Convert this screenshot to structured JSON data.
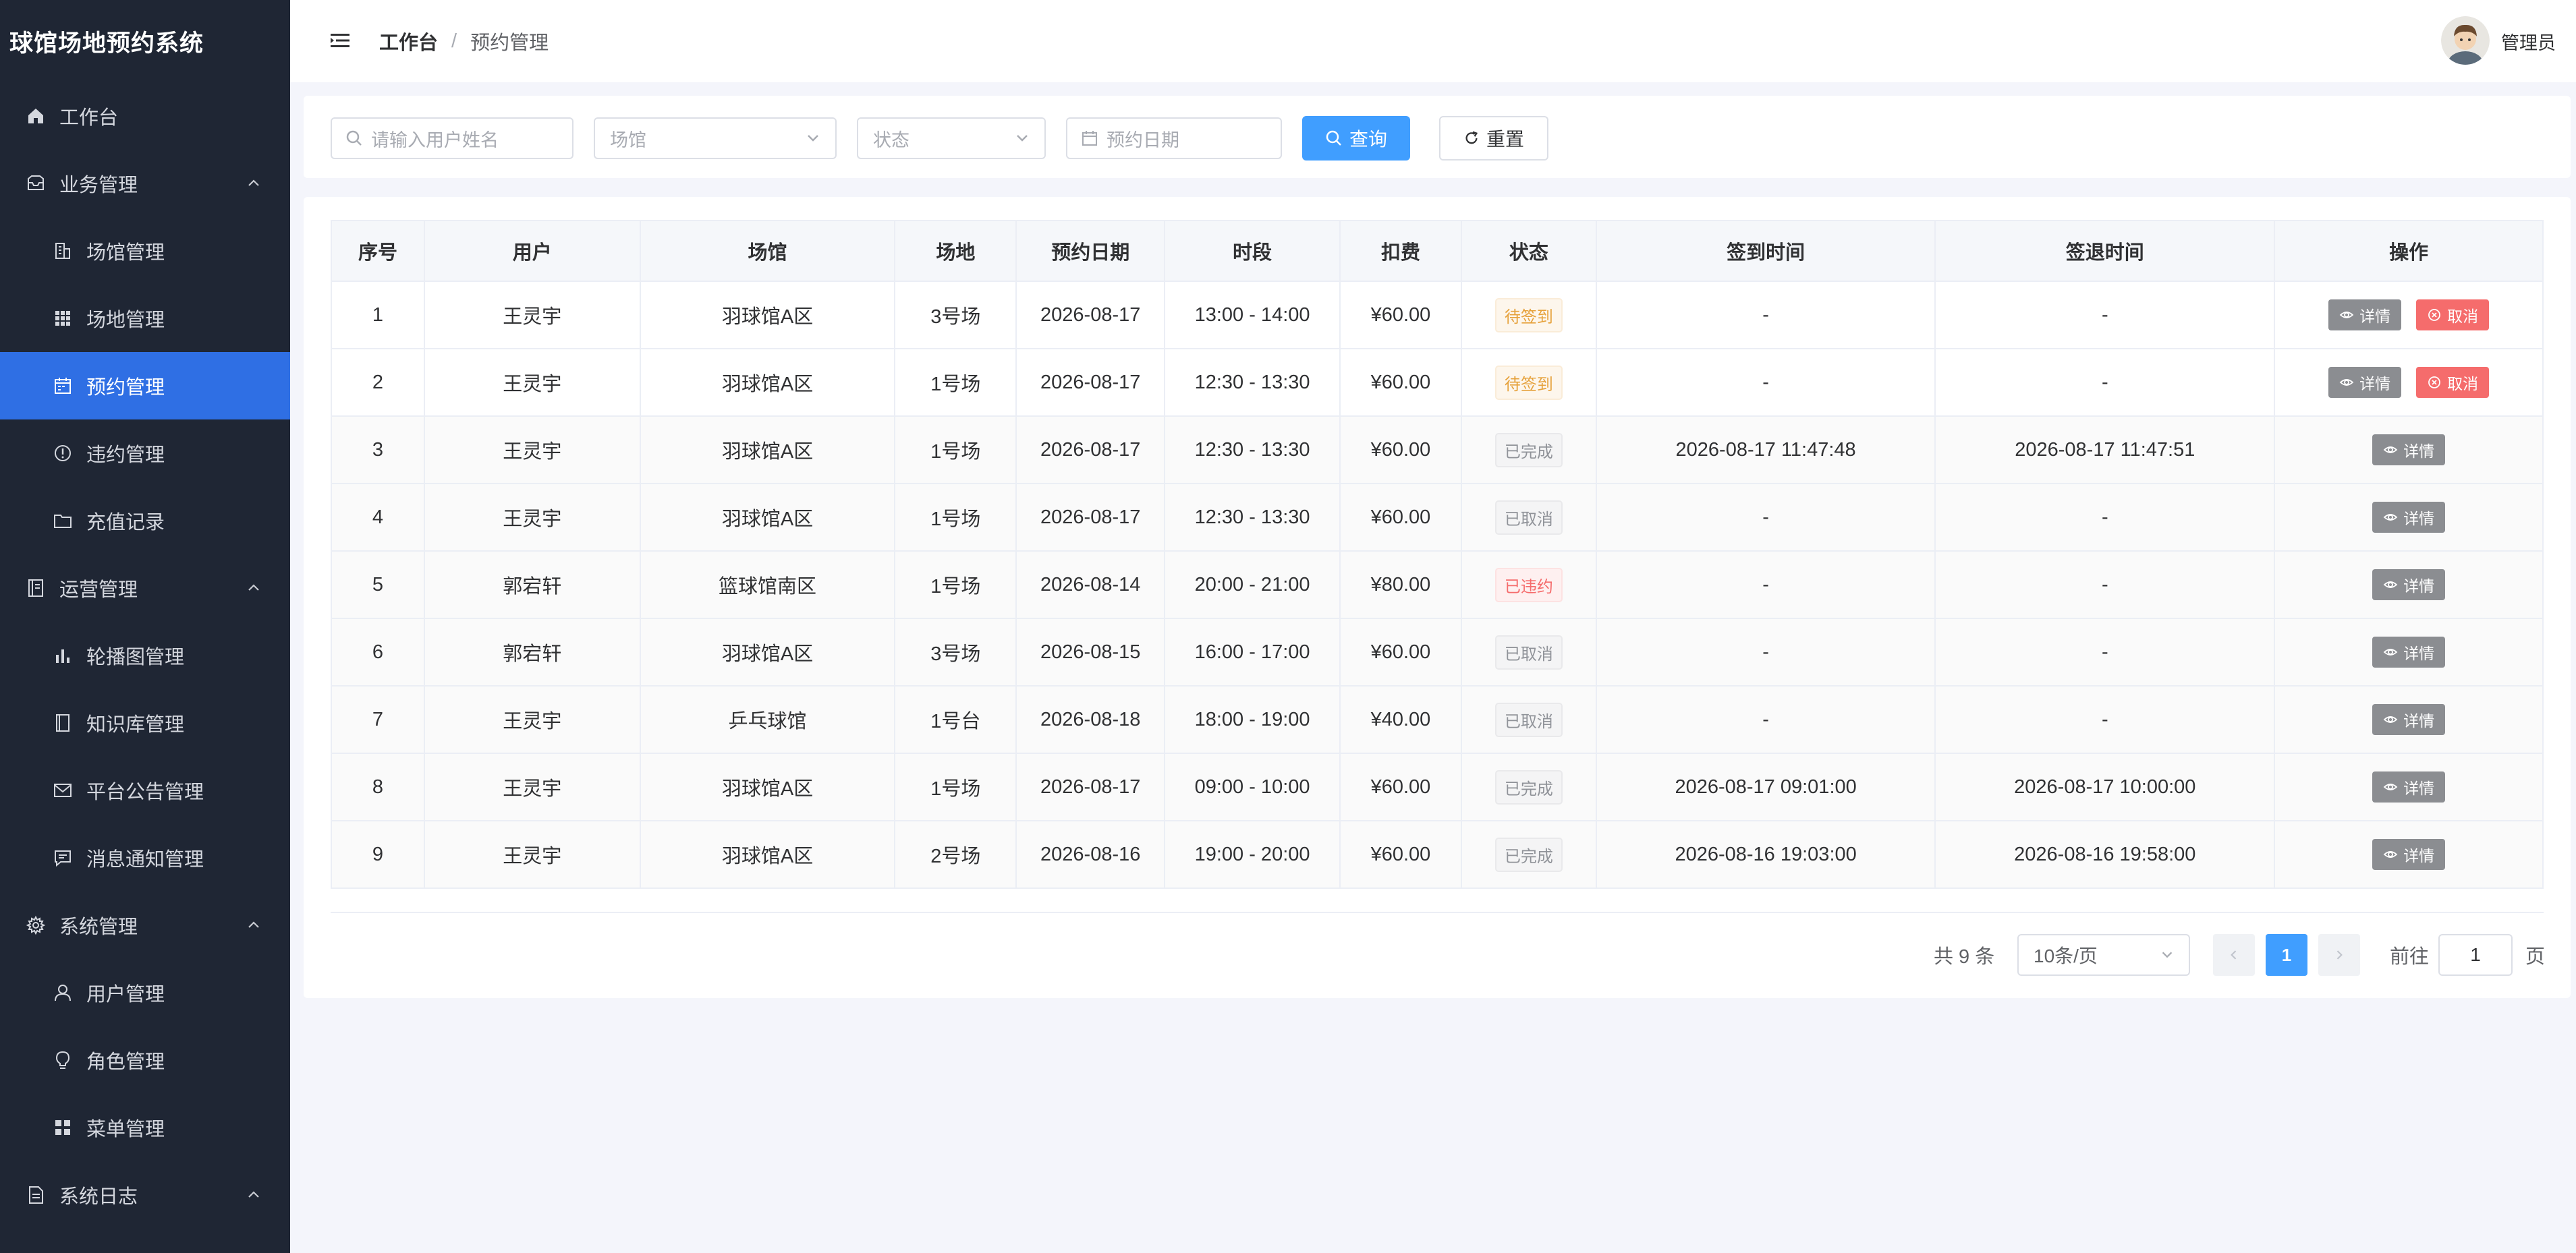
{
  "app": {
    "title": "球馆场地预约系统"
  },
  "sidebar": {
    "items": [
      {
        "label": "工作台",
        "icon": "home-icon",
        "level": "top"
      },
      {
        "label": "业务管理",
        "icon": "inbox-icon",
        "level": "top",
        "expanded": true
      },
      {
        "label": "场馆管理",
        "icon": "building-icon",
        "level": "sub"
      },
      {
        "label": "场地管理",
        "icon": "grid-icon",
        "level": "sub"
      },
      {
        "label": "预约管理",
        "icon": "calendar-icon",
        "level": "sub",
        "active": true
      },
      {
        "label": "违约管理",
        "icon": "warning-circle-icon",
        "level": "sub"
      },
      {
        "label": "充值记录",
        "icon": "folder-icon",
        "level": "sub"
      },
      {
        "label": "运营管理",
        "icon": "notebook-icon",
        "level": "top",
        "expanded": true
      },
      {
        "label": "轮播图管理",
        "icon": "bar-chart-icon",
        "level": "sub"
      },
      {
        "label": "知识库管理",
        "icon": "book-icon",
        "level": "sub"
      },
      {
        "label": "平台公告管理",
        "icon": "mail-icon",
        "level": "sub"
      },
      {
        "label": "消息通知管理",
        "icon": "message-icon",
        "level": "sub"
      },
      {
        "label": "系统管理",
        "icon": "gear-icon",
        "level": "top",
        "expanded": true
      },
      {
        "label": "用户管理",
        "icon": "user-icon",
        "level": "sub"
      },
      {
        "label": "角色管理",
        "icon": "bulb-icon",
        "level": "sub"
      },
      {
        "label": "菜单管理",
        "icon": "menu-grid-icon",
        "level": "sub"
      },
      {
        "label": "系统日志",
        "icon": "document-icon",
        "level": "top",
        "expanded": true
      }
    ]
  },
  "header": {
    "breadcrumb": [
      "工作台",
      "预约管理"
    ],
    "username": "管理员"
  },
  "filters": {
    "user_placeholder": "请输入用户姓名",
    "venue_placeholder": "场馆",
    "status_placeholder": "状态",
    "date_placeholder": "预约日期",
    "query_label": "查询",
    "reset_label": "重置"
  },
  "table": {
    "columns": [
      "序号",
      "用户",
      "场馆",
      "场地",
      "预约日期",
      "时段",
      "扣费",
      "状态",
      "签到时间",
      "签退时间",
      "操作"
    ],
    "rows": [
      {
        "no": "1",
        "user": "王灵宇",
        "venue": "羽球馆A区",
        "court": "3号场",
        "date": "2026-08-17",
        "slot": "13:00 - 14:00",
        "fee": "¥60.00",
        "status": "待签到",
        "status_type": "pending",
        "checkin": "-",
        "checkout": "-",
        "actions": [
          "详情",
          "取消"
        ]
      },
      {
        "no": "2",
        "user": "王灵宇",
        "venue": "羽球馆A区",
        "court": "1号场",
        "date": "2026-08-17",
        "slot": "12:30 - 13:30",
        "fee": "¥60.00",
        "status": "待签到",
        "status_type": "pending",
        "checkin": "-",
        "checkout": "-",
        "actions": [
          "详情",
          "取消"
        ]
      },
      {
        "no": "3",
        "user": "王灵宇",
        "venue": "羽球馆A区",
        "court": "1号场",
        "date": "2026-08-17",
        "slot": "12:30 - 13:30",
        "fee": "¥60.00",
        "status": "已完成",
        "status_type": "done",
        "checkin": "2026-08-17 11:47:48",
        "checkout": "2026-08-17 11:47:51",
        "actions": [
          "详情"
        ]
      },
      {
        "no": "4",
        "user": "王灵宇",
        "venue": "羽球馆A区",
        "court": "1号场",
        "date": "2026-08-17",
        "slot": "12:30 - 13:30",
        "fee": "¥60.00",
        "status": "已取消",
        "status_type": "cancel",
        "checkin": "-",
        "checkout": "-",
        "actions": [
          "详情"
        ]
      },
      {
        "no": "5",
        "user": "郭宕轩",
        "venue": "篮球馆南区",
        "court": "1号场",
        "date": "2026-08-14",
        "slot": "20:00 - 21:00",
        "fee": "¥80.00",
        "status": "已违约",
        "status_type": "violate",
        "checkin": "-",
        "checkout": "-",
        "actions": [
          "详情"
        ]
      },
      {
        "no": "6",
        "user": "郭宕轩",
        "venue": "羽球馆A区",
        "court": "3号场",
        "date": "2026-08-15",
        "slot": "16:00 - 17:00",
        "fee": "¥60.00",
        "status": "已取消",
        "status_type": "cancel",
        "checkin": "-",
        "checkout": "-",
        "actions": [
          "详情"
        ]
      },
      {
        "no": "7",
        "user": "王灵宇",
        "venue": "乒乓球馆",
        "court": "1号台",
        "date": "2026-08-18",
        "slot": "18:00 - 19:00",
        "fee": "¥40.00",
        "status": "已取消",
        "status_type": "cancel",
        "checkin": "-",
        "checkout": "-",
        "actions": [
          "详情"
        ]
      },
      {
        "no": "8",
        "user": "王灵宇",
        "venue": "羽球馆A区",
        "court": "1号场",
        "date": "2026-08-17",
        "slot": "09:00 - 10:00",
        "fee": "¥60.00",
        "status": "已完成",
        "status_type": "done",
        "checkin": "2026-08-17 09:01:00",
        "checkout": "2026-08-17 10:00:00",
        "actions": [
          "详情"
        ]
      },
      {
        "no": "9",
        "user": "王灵宇",
        "venue": "羽球馆A区",
        "court": "2号场",
        "date": "2026-08-16",
        "slot": "19:00 - 20:00",
        "fee": "¥60.00",
        "status": "已完成",
        "status_type": "done",
        "checkin": "2026-08-16 19:03:00",
        "checkout": "2026-08-16 19:58:00",
        "actions": [
          "详情"
        ]
      }
    ]
  },
  "pagination": {
    "total_text": "共 9 条",
    "page_size": "10条/页",
    "current_page": "1",
    "goto_label": "前往",
    "goto_value": "1",
    "page_suffix": "页"
  },
  "colors": {
    "sidebar_bg": "#1f2634",
    "active_bg": "#2f6fe4",
    "primary": "#409eff",
    "danger": "#f56c6c",
    "warning": "#e6a23c"
  }
}
